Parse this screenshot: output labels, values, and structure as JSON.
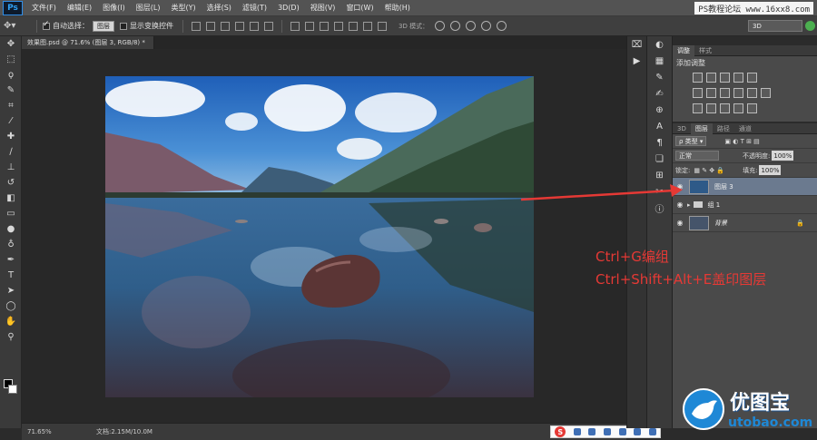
{
  "menubar": {
    "logo": "Ps",
    "items": [
      "文件(F)",
      "编辑(E)",
      "图像(I)",
      "图层(L)",
      "类型(Y)",
      "选择(S)",
      "滤镜(T)",
      "3D(D)",
      "视图(V)",
      "窗口(W)",
      "帮助(H)"
    ],
    "site": "PS教程论坛 www.16xx8.com"
  },
  "options": {
    "auto_select_label": "自动选择：",
    "auto_select_value": "图层",
    "show_transform_label": "显示变换控件",
    "mode_label": "3D 模式：",
    "threed_value": "3D"
  },
  "document": {
    "tab_title": "效果图.psd @ 71.6% (图层 3, RGB/8) *",
    "zoom": "71.65%",
    "doc_size": "文档:2.15M/10.0M"
  },
  "adjust_panel": {
    "tabs": [
      "调整",
      "样式"
    ],
    "title": "添加调整"
  },
  "layers_panel": {
    "tabs": [
      "3D",
      "图层",
      "路径",
      "通道"
    ],
    "filter_kind": "类型",
    "blend_mode": "正常",
    "opacity_label": "不透明度:",
    "opacity_value": "100%",
    "lock_label": "锁定:",
    "fill_label": "填充:",
    "fill_value": "100%",
    "layers": [
      {
        "name": "图层 3",
        "selected": true
      },
      {
        "name": "组 1",
        "selected": false
      },
      {
        "name": "背景",
        "selected": false
      }
    ]
  },
  "annotation": {
    "line1": "Ctrl+G编组",
    "line2": "Ctrl+Shift+Alt+E盖印图层",
    "color": "#e53935"
  },
  "brand": {
    "cn": "优图宝",
    "en": "utobao.com"
  }
}
